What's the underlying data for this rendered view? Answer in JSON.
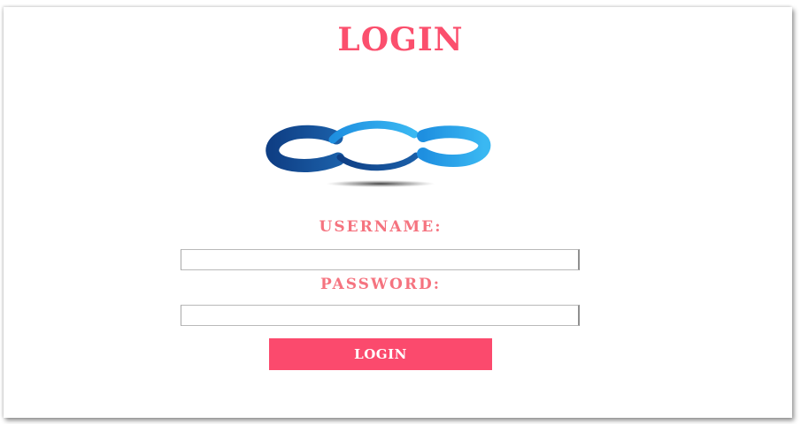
{
  "header": {
    "title": "LOGIN"
  },
  "logo": {
    "icon": "cloud-logo-icon"
  },
  "form": {
    "username_label": "USERNAME:",
    "username_value": "",
    "password_label": "PASSWORD:",
    "password_value": "",
    "submit_label": "LOGIN"
  },
  "colors": {
    "accent": "#fb4a6d",
    "label": "#f5737f",
    "logo_dark": "#123e80",
    "logo_light": "#27a8e8"
  }
}
